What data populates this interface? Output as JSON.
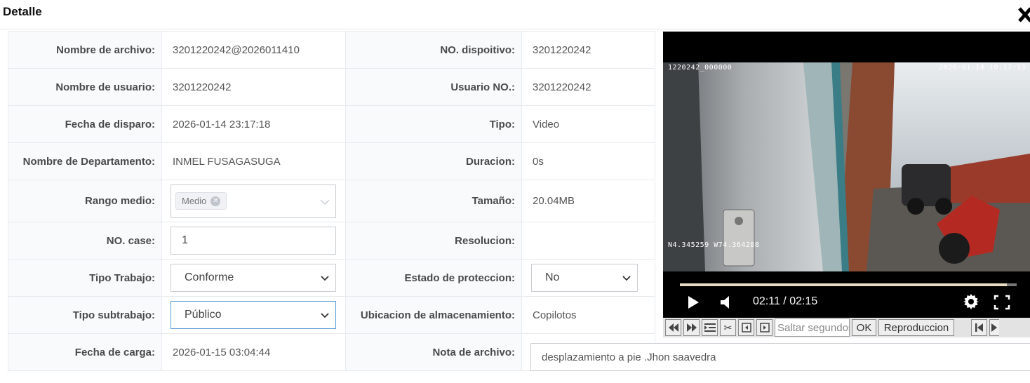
{
  "dialog": {
    "title": "Detalle",
    "close_icon": "close-icon"
  },
  "fields": {
    "nombre_archivo": {
      "label": "Nombre de archivo:",
      "value": "3201220242@2026011410"
    },
    "no_dispositivo": {
      "label": "NO. dispoitivo:",
      "value": "3201220242"
    },
    "nombre_usuario": {
      "label": "Nombre de usuario:",
      "value": "3201220242"
    },
    "usuario_no": {
      "label": "Usuario NO.:",
      "value": "3201220242"
    },
    "fecha_disparo": {
      "label": "Fecha de disparo:",
      "value": "2026-01-14 23:17:18"
    },
    "tipo": {
      "label": "Tipo:",
      "value": "Video"
    },
    "departamento": {
      "label": "Nombre de Departamento:",
      "value": "INMEL FUSAGASUGA"
    },
    "duracion": {
      "label": "Duracion:",
      "value": "0s"
    },
    "rango_medio": {
      "label": "Rango medio:",
      "tag": "Medio"
    },
    "tamano": {
      "label": "Tamaño:",
      "value": "20.04MB"
    },
    "no_case": {
      "label": "NO. case:",
      "value": "1"
    },
    "resolucion": {
      "label": "Resolucion:",
      "value": ""
    },
    "tipo_trabajo": {
      "label": "Tipo Trabajo:",
      "value": "Conforme"
    },
    "estado_proteccion": {
      "label": "Estado de proteccion:",
      "value": "No"
    },
    "tipo_subtrabajo": {
      "label": "Tipo subtrabajo:",
      "value": "Público"
    },
    "ubicacion": {
      "label": "Ubicacion de almacenamiento:",
      "value": "Copilotos"
    },
    "fecha_carga": {
      "label": "Fecha de carga:",
      "value": "2026-01-15 03:04:44"
    },
    "nota": {
      "label": "Nota de archivo:",
      "value": "desplazamiento a pie .Jhon saavedra"
    }
  },
  "player": {
    "osd_id": "1220242_000000",
    "osd_datetime": "2026-01-14 10:17:13",
    "osd_gps": "N4.345259 W74.364288",
    "time": "02:11 / 02:15",
    "progress_fraction": 0.97,
    "jump_placeholder": "Saltar segundos",
    "ok_label": "OK",
    "playback_label": "Reproduccion"
  },
  "colors": {
    "accent_border": "#5b9bd5",
    "label_bg": "#f9fafb",
    "video_bg": "#000000"
  }
}
